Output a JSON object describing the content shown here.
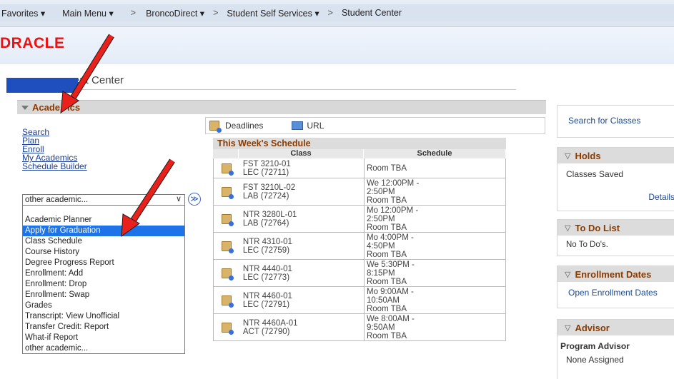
{
  "nav": {
    "favorites": "Favorites",
    "main_menu": "Main Menu",
    "sep": ">",
    "crumb1": "BroncoDirect",
    "crumb2": "Student Self Services",
    "crumb3": "Student Center"
  },
  "logo": "DRACLE",
  "page": {
    "title": "ent Center"
  },
  "academics": {
    "header": "Acade",
    "header_tail": "ics",
    "links": [
      "Search",
      "Plan",
      "Enroll",
      "My Academics",
      "Schedule Builder"
    ],
    "select_value": "other academic...",
    "go_label": "≫",
    "dropdown": [
      "Academic Planner",
      "Apply for Graduation",
      "Class Schedule",
      "Course History",
      "Degree Progress Report",
      "Enrollment: Add",
      "Enrollment: Drop",
      "Enrollment: Swap",
      "Grades",
      "Transcript: View Unofficial",
      "Transfer Credit: Report",
      "What-if Report",
      "other academic..."
    ],
    "selected_index": 1
  },
  "toolbar": {
    "deadlines": "Deadlines",
    "url": "URL"
  },
  "schedule": {
    "title": "This Week's Schedule",
    "col_class": "Class",
    "col_schedule": "Schedule",
    "rows": [
      {
        "c1": "FST 3210-01",
        "c2": "LEC (72711)",
        "s": [
          "Room  TBA"
        ]
      },
      {
        "c1": "FST 3210L-02",
        "c2": "LAB (72724)",
        "s": [
          "We 12:00PM -",
          "2:50PM",
          "Room  TBA"
        ]
      },
      {
        "c1": "NTR 3280L-01",
        "c2": "LAB (72764)",
        "s": [
          "Mo 12:00PM -",
          "2:50PM",
          "Room  TBA"
        ]
      },
      {
        "c1": "NTR 4310-01",
        "c2": "LEC (72759)",
        "s": [
          "Mo 4:00PM -",
          "4:50PM",
          "Room  TBA"
        ]
      },
      {
        "c1": "NTR 4440-01",
        "c2": "LEC (72773)",
        "s": [
          "We 5:30PM -",
          "8:15PM",
          "Room  TBA"
        ]
      },
      {
        "c1": "NTR 4460-01",
        "c2": "LEC (72791)",
        "s": [
          "Mo 9:00AM -",
          "10:50AM",
          "Room  TBA"
        ]
      },
      {
        "c1": "NTR 4460A-01",
        "c2": "ACT (72790)",
        "s": [
          "We 8:00AM -",
          "9:50AM",
          "Room  TBA"
        ]
      }
    ]
  },
  "sidebar": {
    "search_classes": "Search for Classes",
    "holds": {
      "title": "Holds",
      "text": "Classes Saved",
      "link": "Details"
    },
    "todo": {
      "title": "To Do List",
      "text": "No To Do's."
    },
    "enroll": {
      "title": "Enrollment Dates",
      "link": "Open Enrollment Dates"
    },
    "advisor": {
      "title": "Advisor",
      "label": "Program Advisor",
      "text": "None Assigned"
    }
  }
}
